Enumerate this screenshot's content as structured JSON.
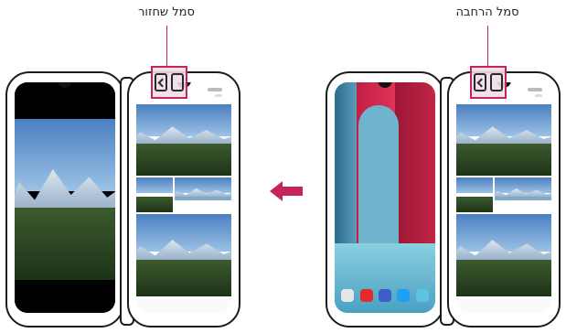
{
  "callouts": {
    "left": "סמל שחזור",
    "right": "סמל הרחבה"
  },
  "icons": {
    "swap": "swap-screen-icon",
    "arrow": "left-arrow-icon"
  },
  "colors": {
    "highlight": "#c4255e",
    "arrow": "#c4255e"
  }
}
